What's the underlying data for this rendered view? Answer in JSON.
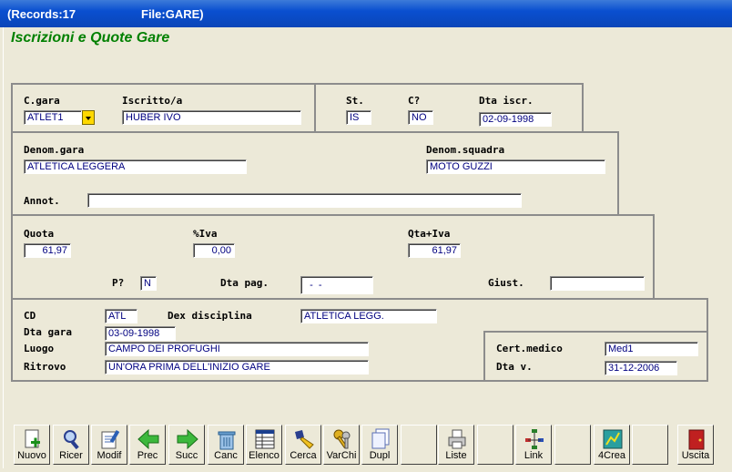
{
  "window": {
    "records": "(Records:17",
    "file": "File:GARE)"
  },
  "form_title": "Iscrizioni e Quote Gare",
  "labels": {
    "cgara": "C.gara",
    "iscritto": "Iscritto/a",
    "st": "St.",
    "c": "C?",
    "dta_iscr": "Dta iscr.",
    "denom_gara": "Denom.gara",
    "denom_squadra": "Denom.squadra",
    "annot": "Annot.",
    "quota": "Quota",
    "iva": "%Iva",
    "qta_iva": "Qta+Iva",
    "p": "P?",
    "dta_pag": "Dta pag.",
    "giust": "Giust.",
    "cd": "CD",
    "dex_disciplina": "Dex disciplina",
    "dta_gara": "Dta gara",
    "luogo": "Luogo",
    "ritrovo": "Ritrovo",
    "cert_medico": "Cert.medico",
    "dta_v": "Dta v."
  },
  "fields": {
    "cgara": "ATLET1",
    "iscritto": "HUBER IVO",
    "st": "IS",
    "c": "NO",
    "dta_iscr": "02-09-1998",
    "denom_gara": "ATLETICA LEGGERA",
    "denom_squadra": "MOTO GUZZI",
    "annot": "",
    "quota": "61,97",
    "iva": "0,00",
    "qta_iva": "61,97",
    "p": "N",
    "dta_pag": "  -  -",
    "giust": "",
    "cd": "ATL",
    "dex_disciplina": "ATLETICA LEGG.",
    "dta_gara": "03-09-1998",
    "luogo": "CAMPO DEI PROFUGHI",
    "ritrovo": "UN'ORA PRIMA DELL'INIZIO GARE",
    "cert_medico": "Med1",
    "dta_v": "31-12-2006"
  },
  "toolbar": {
    "nuovo": "Nuovo",
    "ricer": "Ricer",
    "modif": "Modif",
    "prec": "Prec",
    "succ": "Succ",
    "canc": "Canc",
    "elenco": "Elenco",
    "cerca": "Cerca",
    "varchi": "VarChi",
    "dupl": "Dupl",
    "liste": "Liste",
    "link": "Link",
    "crea": "4Crea",
    "uscita": "Uscita"
  }
}
